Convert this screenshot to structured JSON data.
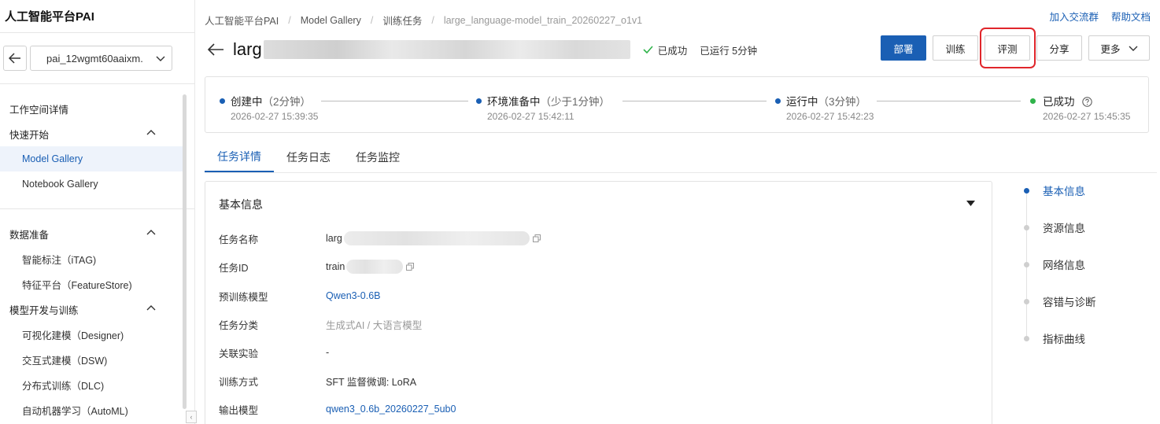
{
  "sidebar": {
    "brand": "人工智能平台PAI",
    "workspace": "pai_12wgmt60aaixm.",
    "items": [
      {
        "label": "工作空间详情",
        "type": "section"
      },
      {
        "label": "快速开始",
        "type": "section",
        "expanded": true
      },
      {
        "label": "Model Gallery",
        "type": "sub",
        "active": true
      },
      {
        "label": "Notebook Gallery",
        "type": "sub"
      },
      {
        "label": "数据准备",
        "type": "section",
        "expanded": true
      },
      {
        "label": "智能标注（iTAG)",
        "type": "sub"
      },
      {
        "label": "特征平台（FeatureStore)",
        "type": "sub"
      },
      {
        "label": "模型开发与训练",
        "type": "section",
        "expanded": true
      },
      {
        "label": "可视化建模（Designer)",
        "type": "sub"
      },
      {
        "label": "交互式建模（DSW)",
        "type": "sub"
      },
      {
        "label": "分布式训练（DLC)",
        "type": "sub"
      },
      {
        "label": "自动机器学习（AutoML)",
        "type": "sub"
      }
    ]
  },
  "header": {
    "breadcrumb": [
      "人工智能平台PAI",
      "Model Gallery",
      "训练任务",
      "large_language-model_train_20260227_o1v1"
    ],
    "links": [
      "加入交流群",
      "帮助文档"
    ],
    "title": "larg",
    "status": "已成功",
    "runtime": "已运行 5分钟",
    "buttons": {
      "deploy": "部署",
      "train": "训练",
      "evaluate": "评测",
      "share": "分享",
      "more": "更多"
    }
  },
  "progress": [
    {
      "name": "创建中",
      "duration": "（2分钟）",
      "time": "2026-02-27 15:39:35",
      "color": "#1a5fb4"
    },
    {
      "name": "环境准备中",
      "duration": "（少于1分钟）",
      "time": "2026-02-27 15:42:11",
      "color": "#1a5fb4"
    },
    {
      "name": "运行中",
      "duration": "（3分钟）",
      "time": "2026-02-27 15:42:23",
      "color": "#1a5fb4"
    },
    {
      "name": "已成功",
      "duration": "",
      "time": "2026-02-27 15:45:35",
      "color": "#2fb34a"
    }
  ],
  "tabs": [
    "任务详情",
    "任务日志",
    "任务监控"
  ],
  "basic_info": {
    "title": "基本信息",
    "rows": [
      {
        "label": "任务名称",
        "value": "larg"
      },
      {
        "label": "任务ID",
        "value": "train"
      },
      {
        "label": "预训练模型",
        "value": "Qwen3-0.6B"
      },
      {
        "label": "任务分类",
        "value": "生成式AI / 大语言模型"
      },
      {
        "label": "关联实验",
        "value": "-"
      },
      {
        "label": "训练方式",
        "value": "SFT 监督微调: LoRA"
      },
      {
        "label": "输出模型",
        "value": "qwen3_0.6b_20260227_5ub0"
      }
    ]
  },
  "anchors": [
    "基本信息",
    "资源信息",
    "网络信息",
    "容错与诊断",
    "指标曲线"
  ],
  "colors": {
    "accent": "#1a5fb4",
    "success": "#2fb34a",
    "highlight": "#e0262b"
  }
}
